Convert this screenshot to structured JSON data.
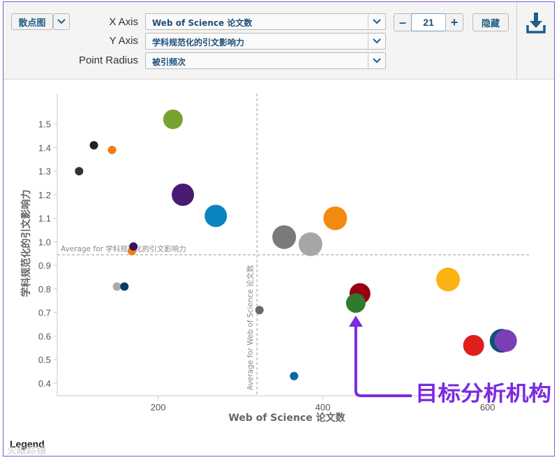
{
  "toolbar": {
    "chart_type_label": "散点图",
    "x_axis_label": "X Axis",
    "x_axis_value": "Web of Science 论文数",
    "y_axis_label": "Y Axis",
    "y_axis_value": "学科规范化的引文影响力",
    "radius_label": "Point Radius",
    "radius_value": "被引频次",
    "count_value": "21",
    "minus_label": "–",
    "plus_label": "+",
    "hide_label": "隐藏"
  },
  "legend_label": "Legend",
  "watermark": "火眼踪镜",
  "annotation": {
    "text": "目标分析机构",
    "color": "#7b2be0"
  },
  "icons": {
    "download": "download-icon",
    "chevron": "chevron-down-icon"
  },
  "chart_data": {
    "type": "scatter",
    "xlabel": "Web of Science 论文数",
    "ylabel": "学科规范化的引文影响力",
    "xlim": [
      80,
      635
    ],
    "ylim": [
      0.37,
      1.6
    ],
    "xticks": [
      200,
      400,
      600
    ],
    "yticks": [
      0.4,
      0.5,
      0.6,
      0.7,
      0.8,
      0.9,
      1.0,
      1.1,
      1.2,
      1.3,
      1.4,
      1.5
    ],
    "ytick_labels": [
      "0.4",
      "0.5",
      "0.6",
      "0.7",
      "0.8",
      "0.9",
      "1.0",
      "1.1",
      "1.2",
      "1.3",
      "1.4",
      "1.5"
    ],
    "xtick_labels": [
      "200",
      "400",
      "600"
    ],
    "reference_lines": {
      "x_avg": {
        "value": 320,
        "label": "Average for Web of Science 论文数"
      },
      "y_avg": {
        "value": 0.945,
        "label": "Average for 学科规范化的引文影响力"
      }
    },
    "grid": false,
    "points": [
      {
        "x": 104,
        "y": 1.3,
        "r": 6,
        "color": "#333333"
      },
      {
        "x": 122,
        "y": 1.41,
        "r": 6,
        "color": "#222222"
      },
      {
        "x": 144,
        "y": 1.39,
        "r": 6,
        "color": "#f07d19"
      },
      {
        "x": 150,
        "y": 0.81,
        "r": 6,
        "color": "#a9a9a9"
      },
      {
        "x": 159,
        "y": 0.81,
        "r": 6,
        "color": "#0f3a5f"
      },
      {
        "x": 168,
        "y": 0.96,
        "r": 6,
        "color": "#f07d19"
      },
      {
        "x": 170,
        "y": 0.98,
        "r": 6,
        "color": "#3b1256"
      },
      {
        "x": 218,
        "y": 1.52,
        "r": 14,
        "color": "#78a22f"
      },
      {
        "x": 230,
        "y": 1.2,
        "r": 16,
        "color": "#4a1a72"
      },
      {
        "x": 270,
        "y": 1.11,
        "r": 16,
        "color": "#0a84c1"
      },
      {
        "x": 323,
        "y": 0.71,
        "r": 6,
        "color": "#6a6a63"
      },
      {
        "x": 353,
        "y": 1.02,
        "r": 17,
        "color": "#7a7a7a"
      },
      {
        "x": 365,
        "y": 0.43,
        "r": 6,
        "color": "#0b67a3"
      },
      {
        "x": 385,
        "y": 0.99,
        "r": 17,
        "color": "#a6a6a6"
      },
      {
        "x": 415,
        "y": 1.1,
        "r": 17,
        "color": "#f28a12"
      },
      {
        "x": 445,
        "y": 0.78,
        "r": 15,
        "color": "#990011"
      },
      {
        "x": 440,
        "y": 0.74,
        "r": 14,
        "color": "#2f7a2f"
      },
      {
        "x": 552,
        "y": 0.84,
        "r": 17,
        "color": "#fbb314"
      },
      {
        "x": 583,
        "y": 0.56,
        "r": 15,
        "color": "#e01e1e"
      },
      {
        "x": 617,
        "y": 0.58,
        "r": 17,
        "color": "#12507a"
      },
      {
        "x": 622,
        "y": 0.58,
        "r": 16,
        "color": "#7b3fb6"
      }
    ],
    "highlight_point": {
      "x": 440,
      "y": 0.74
    }
  }
}
